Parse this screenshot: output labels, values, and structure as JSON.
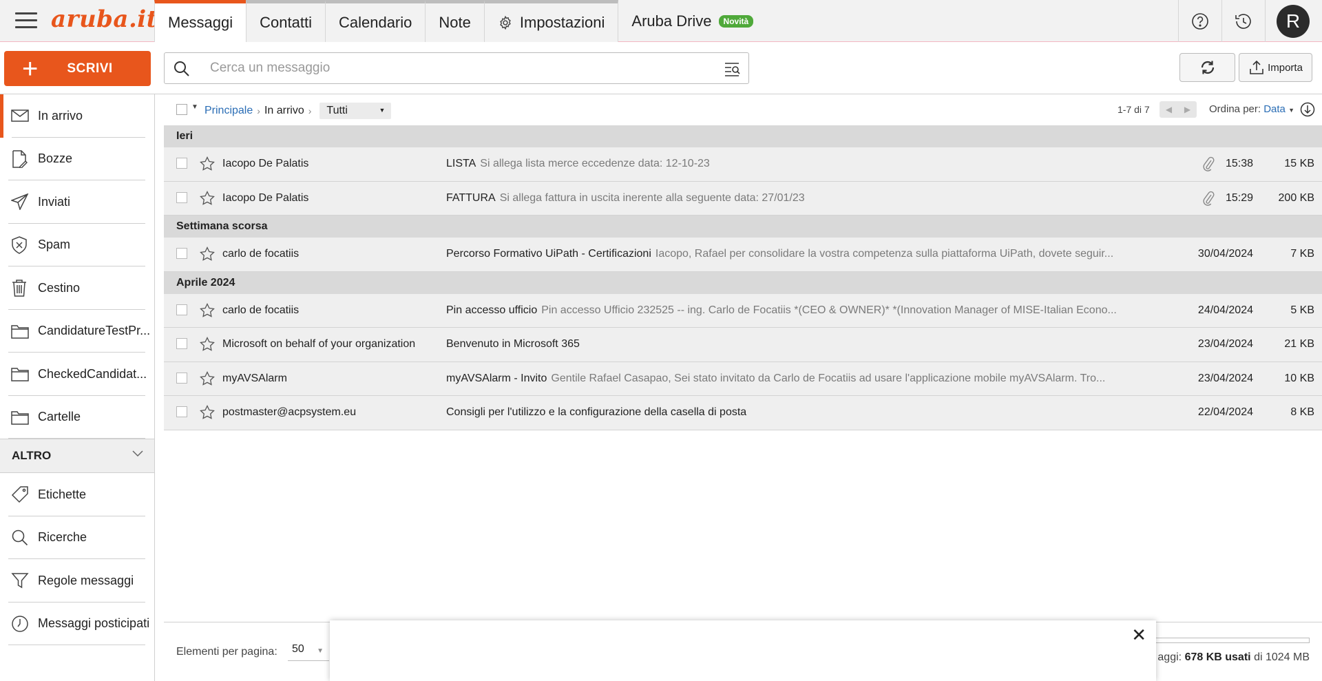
{
  "app": {
    "logo": "aruba.it"
  },
  "tabs": [
    {
      "label": "Messaggi",
      "active": true
    },
    {
      "label": "Contatti"
    },
    {
      "label": "Calendario"
    },
    {
      "label": "Note"
    },
    {
      "label": "Impostazioni",
      "icon": "gear-icon"
    }
  ],
  "drive": {
    "label": "Aruba Drive",
    "badge": "Novità"
  },
  "user": {
    "initial": "R"
  },
  "compose": {
    "label": "SCRIVI"
  },
  "search": {
    "placeholder": "Cerca un messaggio"
  },
  "toolbar": {
    "import_label": "Importa"
  },
  "sidebar": {
    "items": [
      {
        "label": "In arrivo",
        "icon": "inbox-icon",
        "active": true
      },
      {
        "label": "Bozze",
        "icon": "draft-icon"
      },
      {
        "label": "Inviati",
        "icon": "send-icon"
      },
      {
        "label": "Spam",
        "icon": "spam-shield-icon"
      },
      {
        "label": "Cestino",
        "icon": "trash-icon"
      },
      {
        "label": "CandidatureTestPr...",
        "icon": "folder-icon"
      },
      {
        "label": "CheckedCandidat...",
        "icon": "folder-icon"
      },
      {
        "label": "Cartelle",
        "icon": "folder-icon"
      }
    ],
    "section_title": "ALTRO",
    "extra": [
      {
        "label": "Etichette",
        "icon": "tag-icon"
      },
      {
        "label": "Ricerche",
        "icon": "search-icon"
      },
      {
        "label": "Regole messaggi",
        "icon": "filter-icon"
      },
      {
        "label": "Messaggi posticipati",
        "icon": "clock-icon"
      }
    ]
  },
  "listbar": {
    "crumb_root": "Principale",
    "crumb_current": "In arrivo",
    "filter": "Tutti",
    "range": "1-7 di 7",
    "sort_label": "Ordina per:",
    "sort_value": "Data"
  },
  "groups": [
    {
      "title": "Ieri",
      "messages": [
        {
          "from": "Iacopo De Palatis",
          "subject": "LISTA",
          "preview": "Si allega lista merce eccedenze data: 12-10-23",
          "attachment": true,
          "date": "15:38",
          "size": "15 KB"
        },
        {
          "from": "Iacopo De Palatis",
          "subject": "FATTURA",
          "preview": "Si allega fattura in uscita inerente alla seguente data: 27/01/23",
          "attachment": true,
          "date": "15:29",
          "size": "200 KB"
        }
      ]
    },
    {
      "title": "Settimana scorsa",
      "messages": [
        {
          "from": "carlo de focatiis",
          "subject": "Percorso Formativo UiPath - Certificazioni",
          "preview": "Iacopo, Rafael per consolidare la vostra competenza sulla piattaforma UiPath, dovete seguir...",
          "attachment": false,
          "date": "30/04/2024",
          "size": "7 KB"
        }
      ]
    },
    {
      "title": "Aprile 2024",
      "messages": [
        {
          "from": "carlo de focatiis",
          "subject": "Pin accesso ufficio",
          "preview": "Pin accesso Ufficio 232525 -- ing. Carlo de Focatiis *(CEO & OWNER)* *(Innovation Manager of MISE-Italian Econo...",
          "attachment": false,
          "date": "24/04/2024",
          "size": "5 KB"
        },
        {
          "from": "Microsoft on behalf of your organization",
          "subject": "Benvenuto in Microsoft 365",
          "preview": "",
          "attachment": false,
          "date": "23/04/2024",
          "size": "21 KB"
        },
        {
          "from": "myAVSAlarm",
          "subject": "myAVSAlarm - Invito",
          "preview": "Gentile Rafael Casapao,   Sei stato invitato da Carlo de Focatiis ad usare l'applicazione mobile myAVSAlarm.   Tro...",
          "attachment": false,
          "date": "23/04/2024",
          "size": "10 KB"
        },
        {
          "from": "postmaster@acpsystem.eu",
          "subject": "Consigli per l'utilizzo e la configurazione della casella di posta",
          "preview": "",
          "attachment": false,
          "date": "22/04/2024",
          "size": "8 KB"
        }
      ]
    }
  ],
  "footer": {
    "per_page_label": "Elementi per pagina:",
    "per_page_value": "50",
    "quota_prefix": "aggi:",
    "quota_used": "678 KB usati",
    "quota_total": "di 1024 MB"
  },
  "colors": {
    "accent": "#e8561c",
    "link": "#2a6db5",
    "badge": "#4fa93a"
  }
}
